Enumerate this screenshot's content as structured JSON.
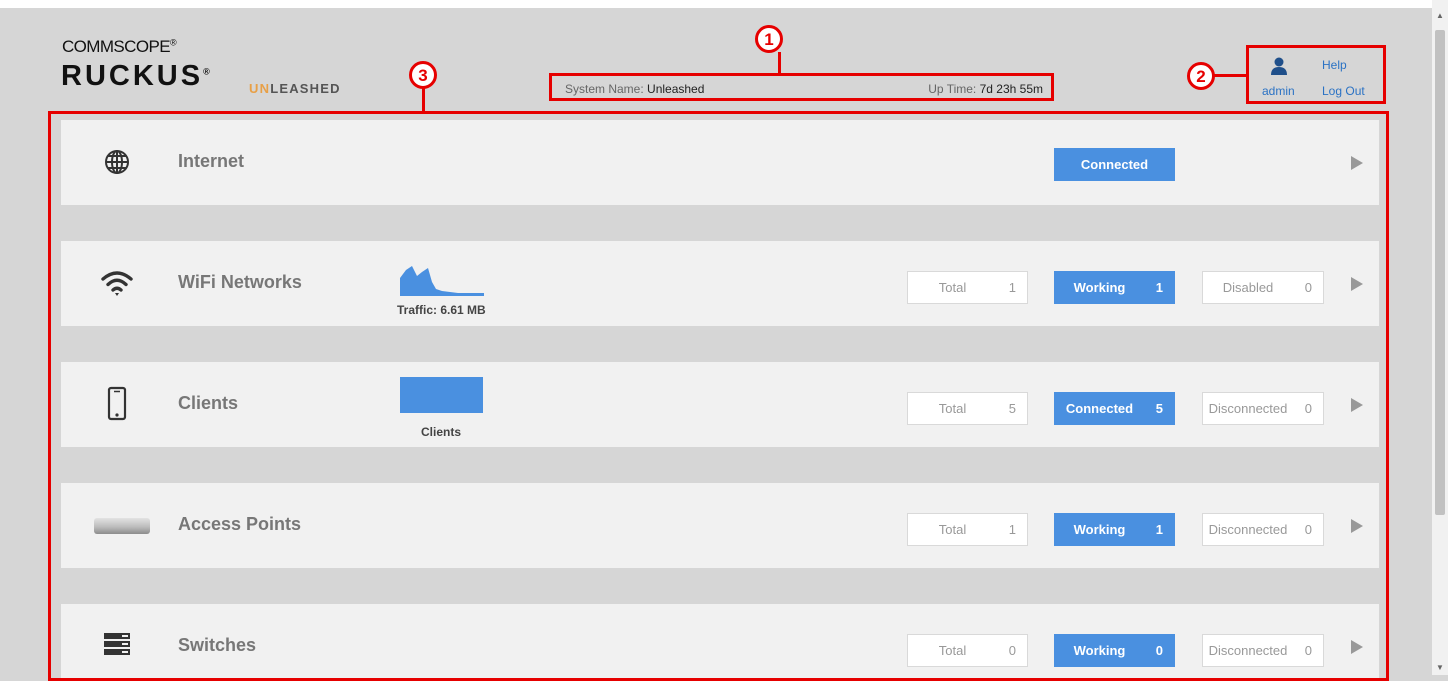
{
  "header": {
    "logo_commscope": "COMMSCOPE",
    "logo_ruckus": "RUCKUS",
    "logo_unleashed_accent": "UN",
    "logo_unleashed_rest": "LEASHED",
    "system_name_label": "System Name:",
    "system_name_value": "Unleashed",
    "uptime_label": "Up Time:",
    "uptime_value": "7d 23h 55m",
    "user": "admin",
    "help": "Help",
    "logout": "Log Out"
  },
  "callouts": [
    "1",
    "2",
    "3"
  ],
  "panels": {
    "internet": {
      "title": "Internet",
      "status": "Connected"
    },
    "wifi": {
      "title": "WiFi Networks",
      "traffic_caption": "Traffic: 6.61 MB",
      "total_label": "Total",
      "total": "1",
      "mid_label": "Working",
      "mid": "1",
      "right_label": "Disabled",
      "right": "0"
    },
    "clients": {
      "title": "Clients",
      "chart_caption": "Clients",
      "total_label": "Total",
      "total": "5",
      "mid_label": "Connected",
      "mid": "5",
      "right_label": "Disconnected",
      "right": "0"
    },
    "access_points": {
      "title": "Access Points",
      "total_label": "Total",
      "total": "1",
      "mid_label": "Working",
      "mid": "1",
      "right_label": "Disconnected",
      "right": "0"
    },
    "switches": {
      "title": "Switches",
      "total_label": "Total",
      "total": "0",
      "mid_label": "Working",
      "mid": "0",
      "right_label": "Disconnected",
      "right": "0"
    }
  },
  "colors": {
    "accent_blue": "#4a90e0",
    "callout_red": "#e60000",
    "brand_orange": "#e8a047"
  }
}
